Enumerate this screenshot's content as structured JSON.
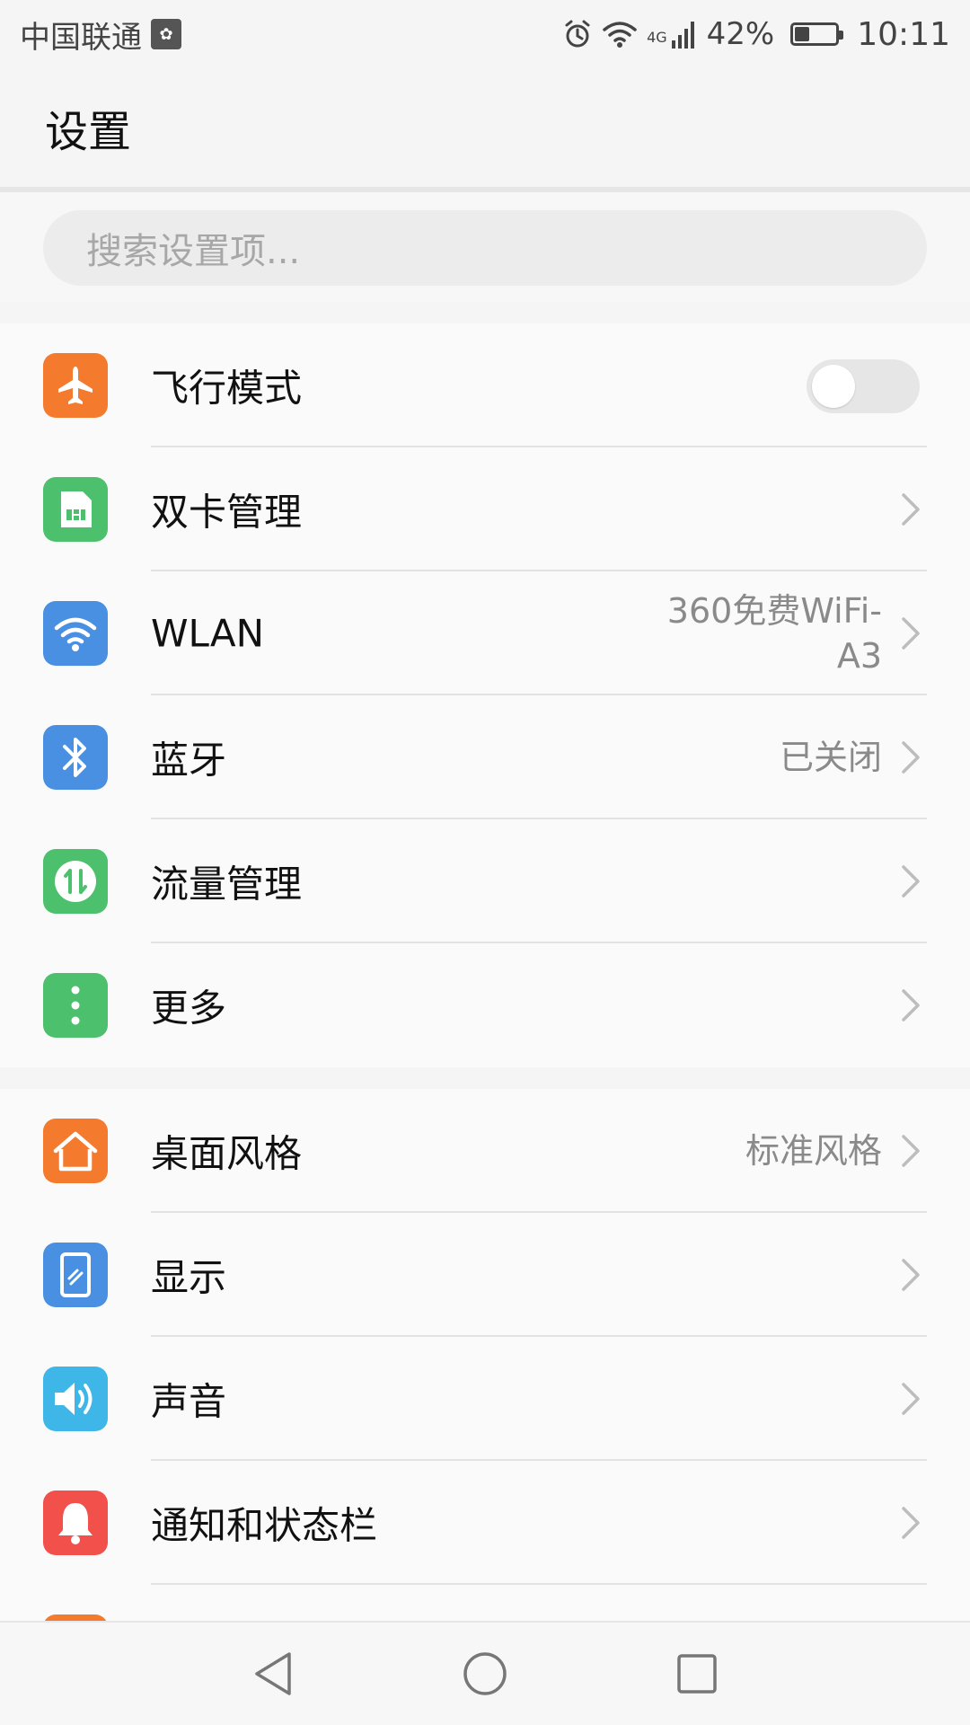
{
  "status_bar": {
    "carrier": "中国联通",
    "battery_percent": "42%",
    "battery_level": 0.42,
    "time": "10:11",
    "network": "4G",
    "icons": [
      "huawei-badge-icon",
      "alarm-icon",
      "wifi-icon",
      "signal-icon",
      "battery-icon"
    ]
  },
  "header": {
    "title": "设置"
  },
  "search": {
    "placeholder": "搜索设置项..."
  },
  "section1": {
    "items": [
      {
        "label": "飞行模式",
        "icon": "airplane-icon",
        "color": "#F47A2D",
        "toggle": false
      },
      {
        "label": "双卡管理",
        "icon": "sim-card-icon",
        "color": "#4CC06C"
      },
      {
        "label": "WLAN",
        "icon": "wifi-icon",
        "color": "#4A90E2",
        "value_line1": "360免费WiFi-",
        "value_line2": "A3"
      },
      {
        "label": "蓝牙",
        "icon": "bluetooth-icon",
        "color": "#4A90E2",
        "value": "已关闭"
      },
      {
        "label": "流量管理",
        "icon": "data-usage-icon",
        "color": "#4CC06C"
      },
      {
        "label": "更多",
        "icon": "more-icon",
        "color": "#4CC06C"
      }
    ]
  },
  "section2": {
    "items": [
      {
        "label": "桌面风格",
        "icon": "home-icon",
        "color": "#F47A2D",
        "value": "标准风格"
      },
      {
        "label": "显示",
        "icon": "display-icon",
        "color": "#4A90E2"
      },
      {
        "label": "声音",
        "icon": "sound-icon",
        "color": "#3EB6E8"
      },
      {
        "label": "通知和状态栏",
        "icon": "bell-icon",
        "color": "#F2504B"
      }
    ]
  },
  "nav_bar": {
    "buttons": [
      "back-icon",
      "home-circle-icon",
      "recents-icon"
    ]
  }
}
